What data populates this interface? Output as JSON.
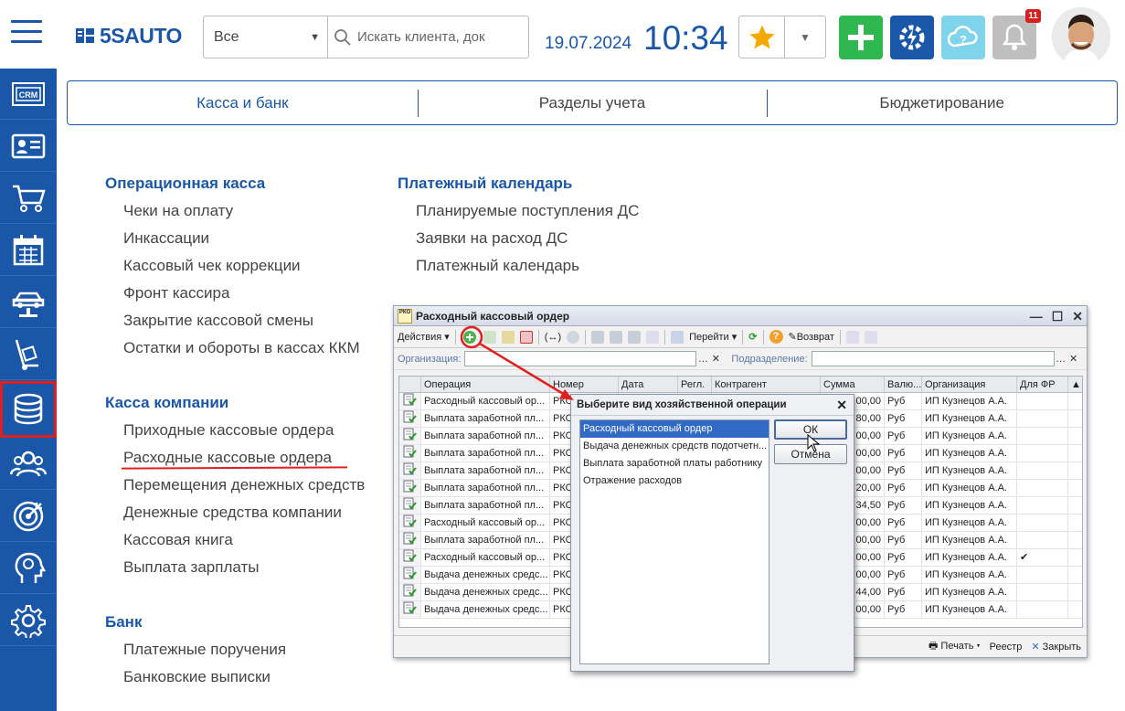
{
  "header": {
    "logo_text": "5SAUTO",
    "search_scope": "Все",
    "search_placeholder": "Искать клиента, док",
    "date": "19.07.2024",
    "time": "10:34",
    "notification_count": "11"
  },
  "tabs": [
    {
      "label": "Касса и банк",
      "active": true
    },
    {
      "label": "Разделы учета",
      "active": false
    },
    {
      "label": "Бюджетирование",
      "active": false
    }
  ],
  "sidebar": [
    {
      "icon": "crm-icon",
      "label": "CRM"
    },
    {
      "icon": "contacts-card-icon"
    },
    {
      "icon": "shopping-cart-icon"
    },
    {
      "icon": "calendar-icon"
    },
    {
      "icon": "car-lift-icon"
    },
    {
      "icon": "warehouse-cart-icon"
    },
    {
      "icon": "coins-stack-icon",
      "active": true
    },
    {
      "icon": "team-icon"
    },
    {
      "icon": "target-icon"
    },
    {
      "icon": "brain-head-icon"
    },
    {
      "icon": "gear-icon"
    }
  ],
  "sections": {
    "cash_ops": {
      "title": "Операционная касса",
      "items": [
        "Чеки на оплату",
        "Инкассации",
        "Кассовый чек коррекции",
        "Фронт кассира",
        "Закрытие кассовой смены",
        "Остатки и обороты в кассах ККМ"
      ]
    },
    "payment_cal": {
      "title": "Платежный календарь",
      "items": [
        "Планируемые поступления ДС",
        "Заявки на расход ДС",
        "Платежный календарь"
      ]
    },
    "company_cash": {
      "title": "Касса компании",
      "items": [
        "Приходные кассовые ордера",
        "Расходные кассовые ордера",
        "Перемещения денежных средств",
        "Денежные средства компании",
        "Кассовая книга",
        "Выплата зарплаты"
      ]
    },
    "bank": {
      "title": "Банк",
      "items": [
        "Платежные поручения",
        "Банковские выписки"
      ]
    }
  },
  "window": {
    "title": "Расходный кассовый ордер",
    "title_icon": "РКО",
    "toolbar": {
      "actions": "Действия",
      "goto": "Перейти",
      "return": "Возврат"
    },
    "filter": {
      "org_label": "Организация:",
      "dept_label": "Подразделение:"
    },
    "columns": [
      "Операция",
      "Номер",
      "Дата",
      "Регл.",
      "Контрагент",
      "Сумма",
      "Валю...",
      "Организация",
      "Для ФР"
    ],
    "rows": [
      {
        "op": "Расходный кассовый ор...",
        "num": "РКО",
        "sum": "00,00",
        "cur": "Руб",
        "org": "ИП Кузнецов А.А.",
        "fr": ""
      },
      {
        "op": "Выплата заработной пл...",
        "num": "РКО",
        "sum": "80,00",
        "cur": "Руб",
        "org": "ИП Кузнецов А.А.",
        "fr": ""
      },
      {
        "op": "Выплата заработной пл...",
        "num": "РКО",
        "sum": "00,00",
        "cur": "Руб",
        "org": "ИП Кузнецов А.А.",
        "fr": ""
      },
      {
        "op": "Выплата заработной пл...",
        "num": "РКО",
        "sum": "00,00",
        "cur": "Руб",
        "org": "ИП Кузнецов А.А.",
        "fr": ""
      },
      {
        "op": "Выплата заработной пл...",
        "num": "РКО",
        "sum": "00,00",
        "cur": "Руб",
        "org": "ИП Кузнецов А.А.",
        "fr": ""
      },
      {
        "op": "Выплата заработной пл...",
        "num": "РКО",
        "sum": "20,00",
        "cur": "Руб",
        "org": "ИП Кузнецов А.А.",
        "fr": ""
      },
      {
        "op": "Выплата заработной пл...",
        "num": "РКО",
        "sum": "34,50",
        "cur": "Руб",
        "org": "ИП Кузнецов А.А.",
        "fr": ""
      },
      {
        "op": "Расходный кассовый ор...",
        "num": "РКО",
        "sum": "00,00",
        "cur": "Руб",
        "org": "ИП Кузнецов А.А.",
        "fr": ""
      },
      {
        "op": "Выплата заработной пл...",
        "num": "РКО",
        "sum": "00,00",
        "cur": "Руб",
        "org": "ИП Кузнецов А.А.",
        "fr": ""
      },
      {
        "op": "Расходный кассовый ор...",
        "num": "РКО",
        "sum": "00,00",
        "cur": "Руб",
        "org": "ИП Кузнецов А.А.",
        "fr": "✔"
      },
      {
        "op": "Выдача денежных средс...",
        "num": "РКО",
        "sum": "00,00",
        "cur": "Руб",
        "org": "ИП Кузнецов А.А.",
        "fr": ""
      },
      {
        "op": "Выдача денежных средс...",
        "num": "РКО",
        "sum": "44,00",
        "cur": "Руб",
        "org": "ИП Кузнецов А.А.",
        "fr": ""
      },
      {
        "op": "Выдача денежных средс...",
        "num": "РКО",
        "sum": "00,00",
        "cur": "Руб",
        "org": "ИП Кузнецов А.А.",
        "fr": ""
      }
    ],
    "footer": {
      "print": "Печать",
      "registry": "Реестр",
      "close": "Закрыть"
    }
  },
  "dialog": {
    "title": "Выберите вид хозяйственной операции",
    "options": [
      "Расходный кассовый ордер",
      "Выдача денежных средств подотчетн...",
      "Выплата заработной платы работнику",
      "Отражение расходов"
    ],
    "ok": "ОК",
    "cancel": "Отмена"
  },
  "colors": {
    "brand": "#1a57a8",
    "accent_green": "#2eb84f",
    "highlight": "#e02020"
  }
}
